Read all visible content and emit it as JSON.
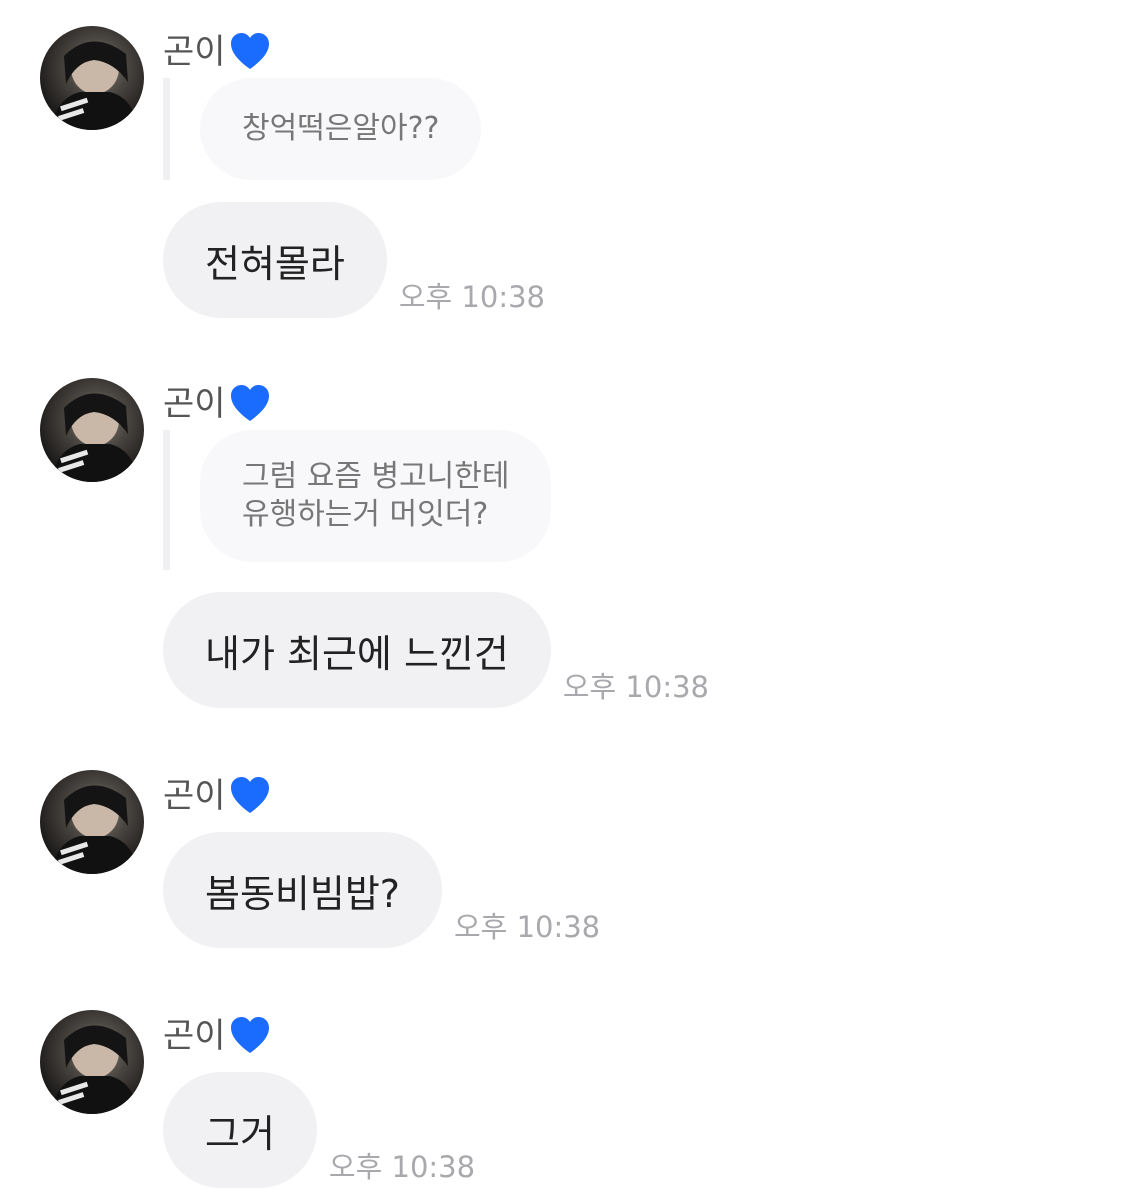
{
  "colors": {
    "heart": "#1a6bff",
    "bubble_bg": "#f1f1f4",
    "quote_bg": "#f8f8fa",
    "time_text": "#a9a9ad"
  },
  "messages": [
    {
      "sender": "곤이",
      "sender_icon": "blue-heart-icon",
      "quote": "창억떡은알아??",
      "text": "전혀몰라",
      "time": "오후 10:38"
    },
    {
      "sender": "곤이",
      "sender_icon": "blue-heart-icon",
      "quote": "그럼 요즘 병고니한테\n유행하는거 머잇더?",
      "text": "내가 최근에 느낀건",
      "time": "오후 10:38"
    },
    {
      "sender": "곤이",
      "sender_icon": "blue-heart-icon",
      "text": "봄동비빔밥?",
      "time": "오후 10:38"
    },
    {
      "sender": "곤이",
      "sender_icon": "blue-heart-icon",
      "text": "그거",
      "time": "오후 10:38"
    }
  ]
}
